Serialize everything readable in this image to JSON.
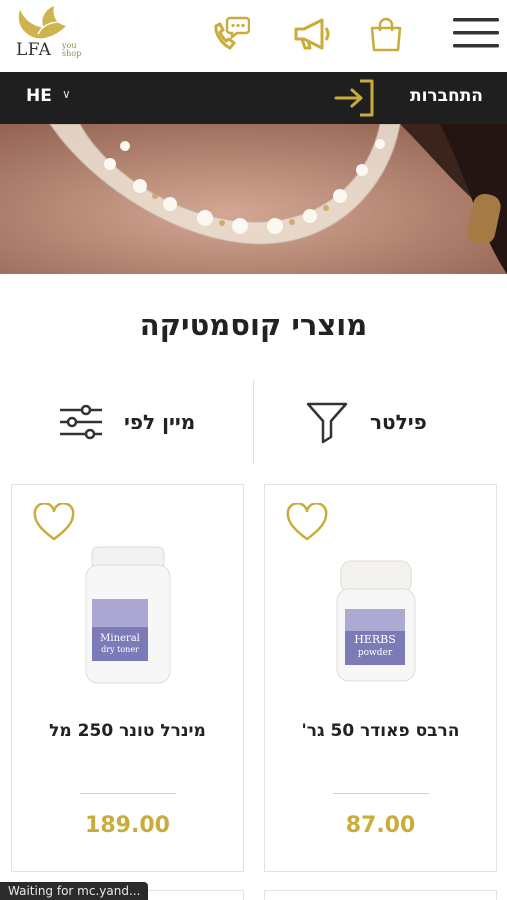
{
  "colors": {
    "gold": "#c9ac3a",
    "dark_bar": "#1f1f1f",
    "text": "#222222"
  },
  "header": {
    "logo_main": "LFA",
    "logo_sub": "you shop",
    "icons": [
      "phone-chat-icon",
      "megaphone-icon",
      "shopping-bag-icon",
      "hamburger-menu-icon"
    ]
  },
  "topbar": {
    "language": "HE",
    "login_label": "התחברות"
  },
  "hero": {
    "image": "necklace-banner-image"
  },
  "page_title": "מוצרי קוסמטיקה",
  "toolbar": {
    "filter_label": "פילטר",
    "sort_label": "מיין לפי"
  },
  "products": [
    {
      "name": "הרבס פאודר 50 גר'",
      "price": "87.00",
      "jar_label_1": "HERBS",
      "jar_label_2": "powder"
    },
    {
      "name": "מינרל טונר 250 מל",
      "price": "189.00",
      "jar_label_1": "Mineral",
      "jar_label_2": "dry toner"
    }
  ],
  "status_bar": "Waiting for mc.yand..."
}
